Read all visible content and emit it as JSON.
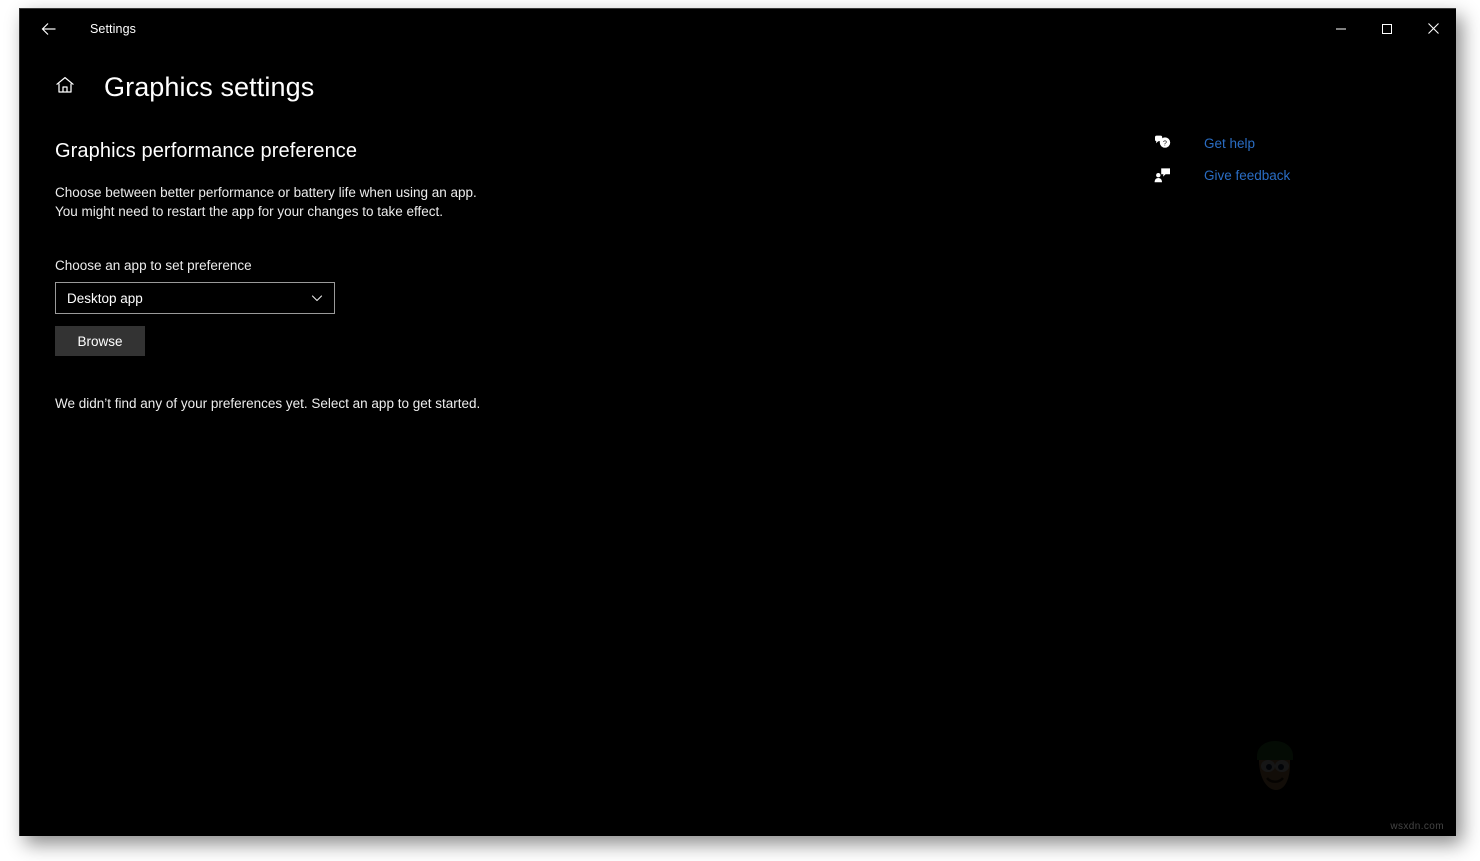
{
  "window": {
    "titlebar": {
      "back_label": "Back",
      "back_icon": "arrow-left-icon",
      "title": "Settings",
      "minimize_label": "Minimize",
      "maximize_label": "Maximize",
      "close_label": "Close"
    },
    "background_color": "#000000"
  },
  "header": {
    "home_icon": "home-icon",
    "title": "Graphics settings"
  },
  "main": {
    "section_title": "Graphics performance preference",
    "description_line1": "Choose between better performance or battery life when using an app.",
    "description_line2": "You might need to restart the app for your changes to take effect.",
    "field_label": "Choose an app to set preference",
    "app_type_select": {
      "value": "Desktop app",
      "chevron_icon": "chevron-down-icon",
      "options": [
        "Desktop app"
      ]
    },
    "browse_button_label": "Browse",
    "empty_state": "We didn’t find any of your preferences yet. Select an app to get started."
  },
  "right_rail": {
    "links": [
      {
        "label": "Get help",
        "icon": "help-bubble-icon"
      },
      {
        "label": "Give feedback",
        "icon": "feedback-person-icon"
      }
    ]
  },
  "watermark": {
    "text": "wsxdn.com"
  },
  "colors": {
    "link": "#2a6dc4",
    "text": "#ededed",
    "button_face": "#333333",
    "combobox_border": "#9a9a9a"
  }
}
